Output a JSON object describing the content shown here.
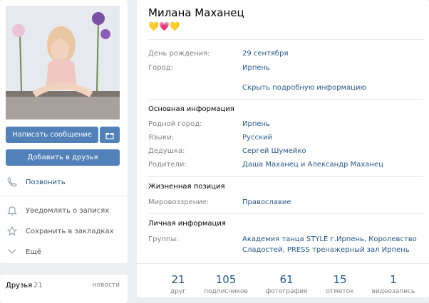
{
  "profile": {
    "name": "Милана Маханец",
    "status_emoji": "💛💗💛"
  },
  "left": {
    "message_button": "Написать сообщение",
    "add_friend_button": "Добавить в друзья",
    "actions": [
      "Позвонить",
      "Уведомлять о записях",
      "Сохранить в закладках",
      "Ещё"
    ]
  },
  "friends": {
    "title": "Друзья",
    "count": "21",
    "link": "новости"
  },
  "info": {
    "birthday_label": "День рождения:",
    "birthday": "29 сентября",
    "city_label": "Город:",
    "city": "Ирпень",
    "toggle": "Скрыть подробную информацию",
    "main_title": "Основная информация",
    "hometown_label": "Родной город:",
    "hometown": "Ирпень",
    "languages_label": "Языки:",
    "languages": "Русский",
    "grandpa_label": "Дедушка:",
    "grandpa": "Сергей Шумейко",
    "parents_label": "Родители:",
    "parents": "Даша Маханец и Александр Маханец",
    "life_title": "Жизненная позиция",
    "worldview_label": "Мировоззрение:",
    "worldview": "Православие",
    "personal_title": "Личная информация",
    "groups_label": "Группы:",
    "groups_line1": "Академия танца STYLE г.Ирпень, Королевство",
    "groups_line2": "Сладостей, PRESS тренажерный зал Ирпень"
  },
  "counters": [
    {
      "number": "21",
      "label": "друг"
    },
    {
      "number": "105",
      "label": "подписчиков"
    },
    {
      "number": "61",
      "label": "фотография"
    },
    {
      "number": "15",
      "label": "отметок"
    },
    {
      "number": "1",
      "label": "видеозапись"
    }
  ],
  "colors": {
    "accent": "#5181b8",
    "link": "#2a5885",
    "label": "#828282",
    "background": "#edeef0"
  }
}
